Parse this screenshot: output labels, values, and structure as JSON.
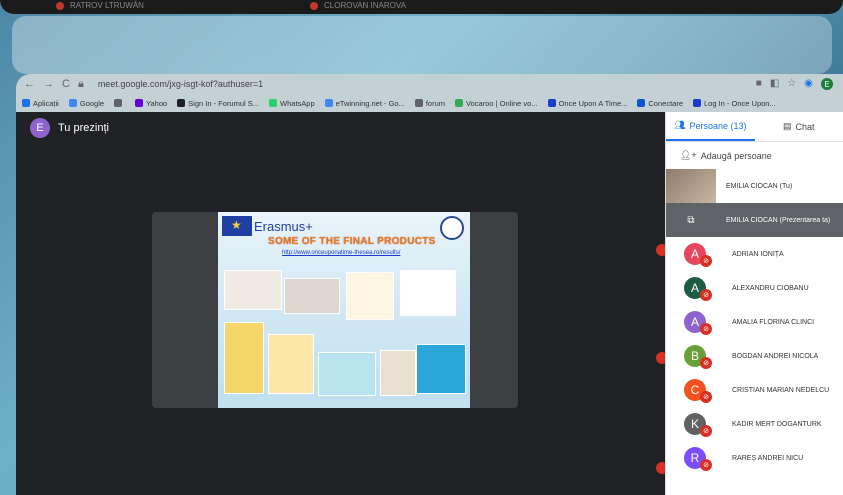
{
  "top_strip": {
    "left_label": "RATROV LTRUWÂN",
    "right_label": "CLOROVAN INAROVA"
  },
  "browser": {
    "url": "meet.google.com/jxg-isgt-kof?authuser=1",
    "profile_initial": "E",
    "bookmarks": [
      {
        "label": "Aplicații",
        "color": "#1a73e8"
      },
      {
        "label": "Google",
        "color": "#4285f4"
      },
      {
        "label": "",
        "color": "#5f6368"
      },
      {
        "label": "Yahoo",
        "color": "#6001d2"
      },
      {
        "label": "Sign In - Forumul S...",
        "color": "#202124"
      },
      {
        "label": "WhatsApp",
        "color": "#25d366"
      },
      {
        "label": "eTwinning.net - Go...",
        "color": "#4285f4"
      },
      {
        "label": "forum",
        "color": "#5f6368"
      },
      {
        "label": "Vocaroo | Online vo...",
        "color": "#34a853"
      },
      {
        "label": "Once Upon A Time...",
        "color": "#1a3dcc"
      },
      {
        "label": "Conectare",
        "color": "#0b57d0"
      },
      {
        "label": "Log In - Once Upon...",
        "color": "#1a3dcc"
      }
    ]
  },
  "presenter": {
    "initial": "E",
    "label": "Tu prezinți"
  },
  "slide": {
    "brand": "Erasmus+",
    "heading": "SOME OF THE FINAL PRODUCTS",
    "link": "http://www.onceuponatime-thesea.ro/results/"
  },
  "sidebar": {
    "tab_people": "Persoane (13)",
    "tab_chat": "Chat",
    "add_people": "Adaugă persoane",
    "participants": [
      {
        "kind": "self",
        "name": "EMILIA CIOCAN (Tu)"
      },
      {
        "kind": "present",
        "name": "EMILIA CIOCAN (Prezentarea ta)"
      },
      {
        "kind": "user",
        "initial": "A",
        "color": "#e8465c",
        "name": "ADRIAN IONIȚĂ"
      },
      {
        "kind": "user",
        "initial": "A",
        "color": "#1e5b43",
        "name": "ALEXANDRU CIOBANU"
      },
      {
        "kind": "user",
        "initial": "A",
        "color": "#8e63ce",
        "name": "AMALIA FLORINA CLINCI"
      },
      {
        "kind": "user",
        "initial": "B",
        "color": "#689f38",
        "name": "BOGDAN ANDREI NICOLA"
      },
      {
        "kind": "user",
        "initial": "C",
        "color": "#f4511e",
        "name": "CRISTIAN MARIAN NEDELCU"
      },
      {
        "kind": "user",
        "initial": "K",
        "color": "#616161",
        "name": "KADIR MERT DOGANTURK"
      },
      {
        "kind": "user",
        "initial": "R",
        "color": "#7c4dff",
        "name": "RAREȘ ANDREI NICU"
      }
    ]
  }
}
